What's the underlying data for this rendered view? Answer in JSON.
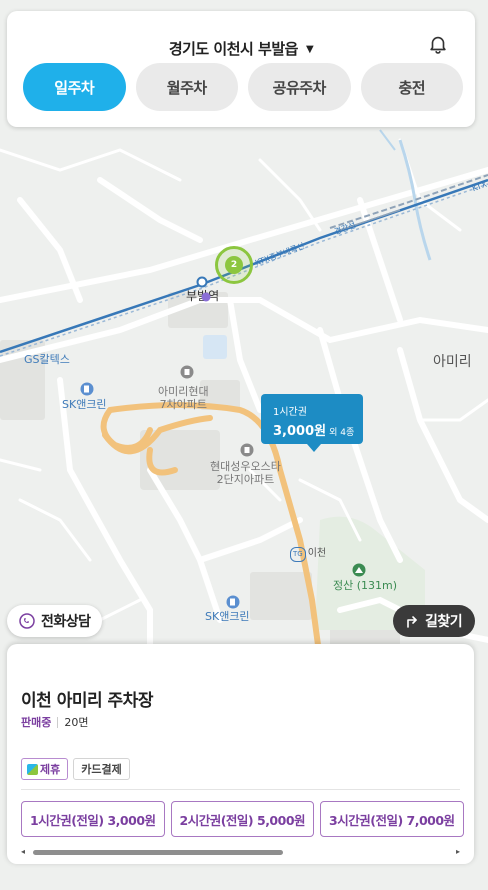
{
  "header": {
    "location": "경기도 이천시 부발읍",
    "location_arrow": "▼",
    "bell_icon": "bell-icon"
  },
  "tabs": [
    {
      "label": "일주차",
      "active": true
    },
    {
      "label": "월주차",
      "active": false
    },
    {
      "label": "공유주차",
      "active": false
    },
    {
      "label": "충전",
      "active": false
    }
  ],
  "map": {
    "labels": {
      "cluster_count": "2",
      "station": "부발역",
      "gs": "GS칼텍스",
      "sk1": "SK앤크린",
      "apt1_line1": "아미리현대",
      "apt1_line2": "7차아파트",
      "apt2_line1": "현대성우오스타",
      "apt2_line2": "2단지아파트",
      "amiri": "아미리",
      "ic": "이천",
      "ic_badge": "TG",
      "mountain": "정산 (131m)",
      "sk2": "SK앤크린",
      "rail1": "KTX중부내륙선",
      "rail2": "경강선",
      "ktx": "KTX"
    },
    "price_pin": {
      "ticket": "1시간권",
      "price": "3,000원",
      "extra": "외 4종"
    }
  },
  "chips": {
    "call_label": "전화상담",
    "route_label": "길찾기"
  },
  "lot": {
    "name": "이천 아미리 주차장",
    "status": "판매중",
    "spaces": "20면",
    "badge_partner": "제휴",
    "badge_card": "카드결제",
    "tickets": [
      "1시간권(전일) 3,000원",
      "2시간권(전일) 5,000원",
      "3시간권(전일) 7,000원"
    ],
    "scroll_left": "◂",
    "scroll_right": "▸"
  },
  "colors": {
    "accent": "#1fb0ea",
    "pin": "#1d8cc4",
    "status": "#7b3fa0"
  }
}
